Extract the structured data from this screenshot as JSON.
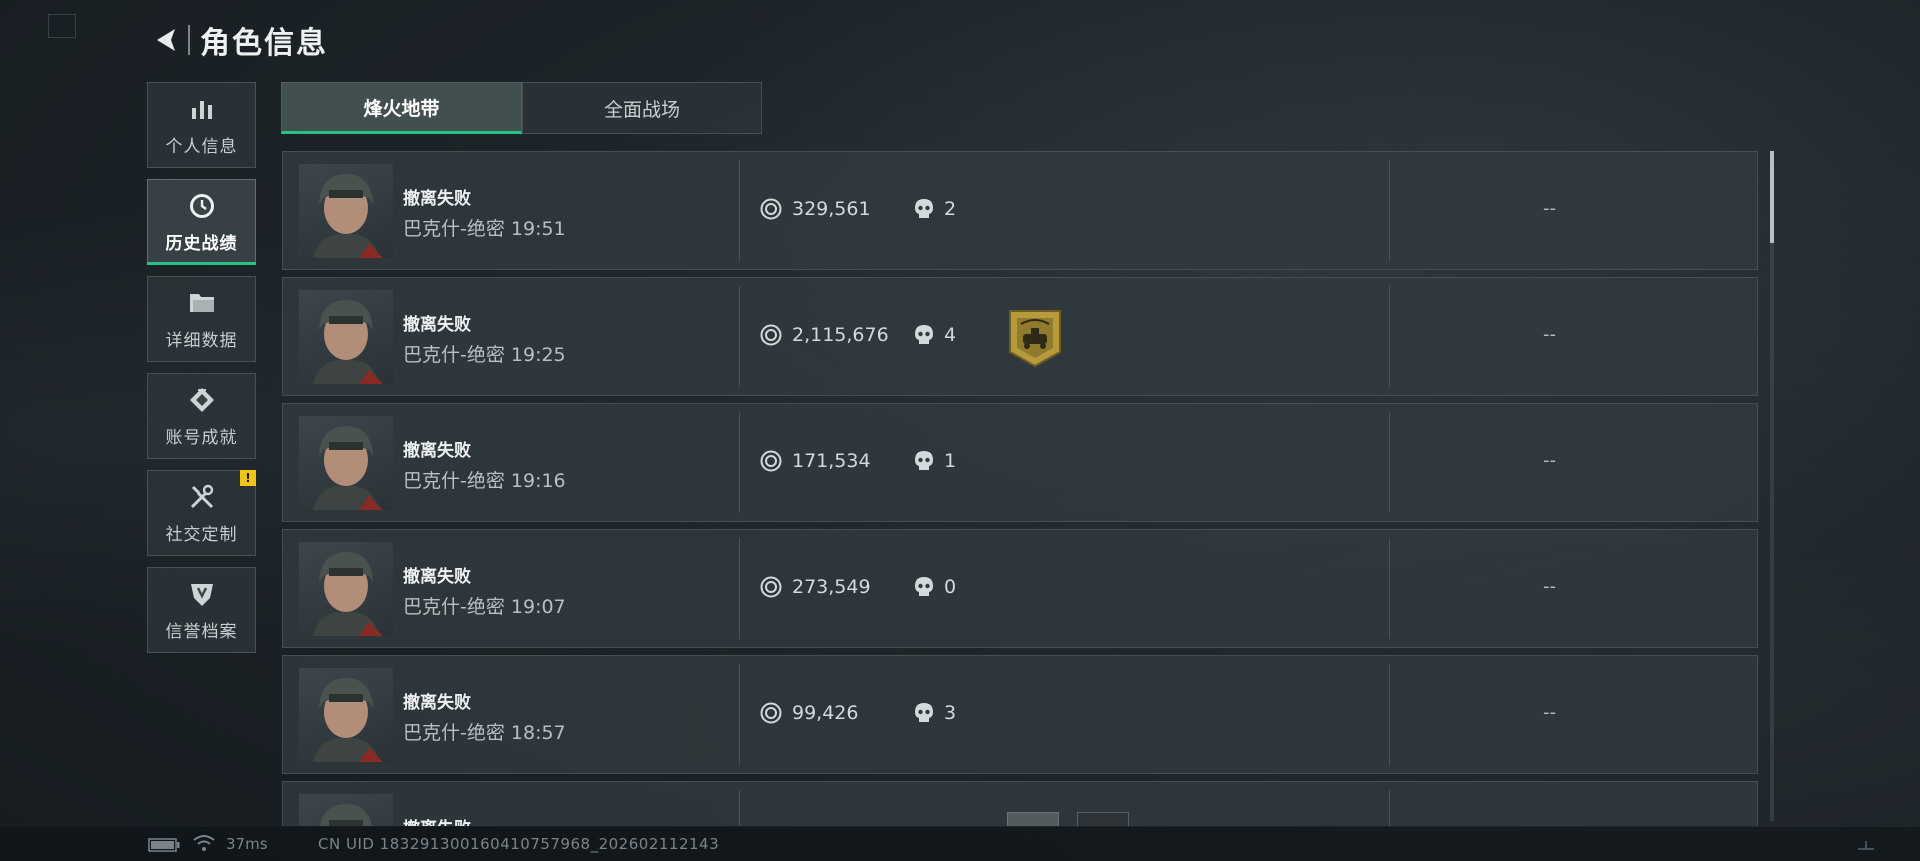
{
  "page": {
    "title": "角色信息"
  },
  "sidebar": {
    "items": [
      {
        "label": "个人信息",
        "icon": "bar-chart-icon",
        "active": false
      },
      {
        "label": "历史战绩",
        "icon": "clock-icon",
        "active": true
      },
      {
        "label": "详细数据",
        "icon": "folder-icon",
        "active": false
      },
      {
        "label": "账号成就",
        "icon": "achievement-icon",
        "active": false
      },
      {
        "label": "社交定制",
        "icon": "tools-icon",
        "active": false,
        "badge": "!"
      },
      {
        "label": "信誉档案",
        "icon": "shield-icon",
        "active": false
      }
    ]
  },
  "tabs": [
    {
      "label": "烽火地带",
      "active": true
    },
    {
      "label": "全面战场",
      "active": false
    }
  ],
  "records": [
    {
      "status": "撤离失败",
      "map_time": "巴克什-绝密 19:51",
      "value": "329,561",
      "kills": "2",
      "medal": false,
      "extra": "--"
    },
    {
      "status": "撤离失败",
      "map_time": "巴克什-绝密 19:25",
      "value": "2,115,676",
      "kills": "4",
      "medal": true,
      "extra": "--"
    },
    {
      "status": "撤离失败",
      "map_time": "巴克什-绝密 19:16",
      "value": "171,534",
      "kills": "1",
      "medal": false,
      "extra": "--"
    },
    {
      "status": "撤离失败",
      "map_time": "巴克什-绝密 19:07",
      "value": "273,549",
      "kills": "0",
      "medal": false,
      "extra": "--"
    },
    {
      "status": "撤离失败",
      "map_time": "巴克什-绝密 18:57",
      "value": "99,426",
      "kills": "3",
      "medal": false,
      "extra": "--"
    },
    {
      "status": "撤离失败",
      "partial": true
    }
  ],
  "statusbar": {
    "latency": "37ms",
    "uid": "CN UID 1832913001604107579​68_202602112143"
  },
  "colors": {
    "accent": "#27c18a",
    "badge": "#f0c419",
    "medal": "#b79a3c"
  }
}
